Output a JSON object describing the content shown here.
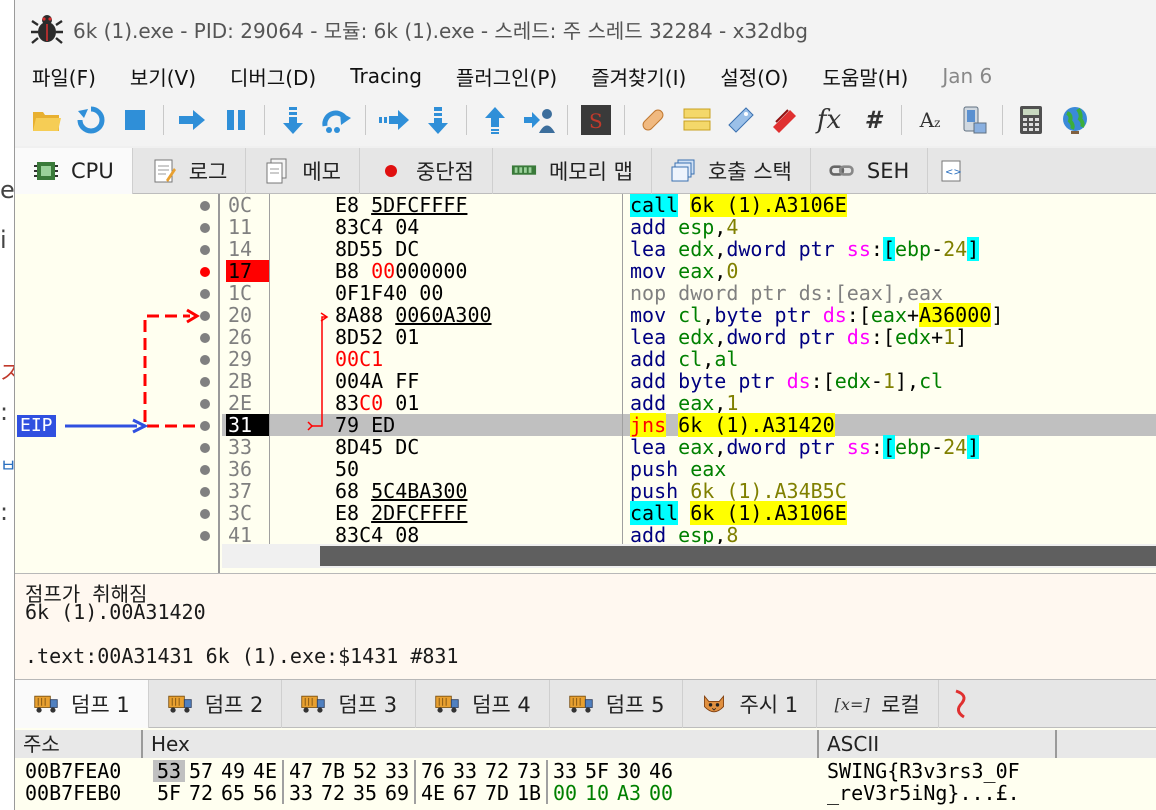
{
  "window": {
    "title": "6k (1).exe - PID: 29064 - 모듈: 6k (1).exe - 스레드: 주 스레드 32284 - x32dbg"
  },
  "background_fragments": [
    "e",
    "i",
    "ス",
    ":",
    "ㅂ",
    ":"
  ],
  "menu": [
    "파일(F)",
    "보기(V)",
    "디버그(D)",
    "Tracing",
    "플러그인(P)",
    "즐겨찾기(I)",
    "설정(O)",
    "도움말(H)",
    "Jan 6"
  ],
  "toolbar_icons": [
    "open-folder-icon",
    "restart-icon",
    "stop-icon",
    "run-arrow-icon",
    "pause-icon",
    "step-into-icon",
    "step-over-icon",
    "trace-into-icon",
    "trace-over-icon",
    "execute-till-return-icon",
    "run-to-user-code-icon",
    "scylla-icon",
    "patch-icon",
    "comments-icon",
    "labels-icon",
    "bookmarks-icon",
    "functions-icon",
    "hash-icon",
    "font-size-icon",
    "calculator-icon",
    "globe-icon"
  ],
  "cpu_tabs": [
    {
      "label": "CPU",
      "icon": "cpu-chip-icon"
    },
    {
      "label": "로그",
      "icon": "log-notepad-icon"
    },
    {
      "label": "메모",
      "icon": "notes-icon"
    },
    {
      "label": "중단점",
      "icon": "breakpoint-dot-icon"
    },
    {
      "label": "메모리 맵",
      "icon": "memory-map-icon"
    },
    {
      "label": "호출 스택",
      "icon": "call-stack-icon"
    },
    {
      "label": "SEH",
      "icon": "seh-chain-icon"
    }
  ],
  "gutter": {
    "eip_label": "EIP"
  },
  "disasm": [
    {
      "addr": "0C",
      "bytes": "E8 5DFCFFFF",
      "ins": "call 6k (1).A3106E"
    },
    {
      "addr": "11",
      "bytes": "83C4 04",
      "ins": "add esp,4"
    },
    {
      "addr": "14",
      "bytes": "8D55 DC",
      "ins": "lea edx,dword ptr ss:[ebp-24]"
    },
    {
      "addr": "17",
      "bytes": "B8 00000000",
      "ins": "mov eax,0",
      "breakpoint": true
    },
    {
      "addr": "1C",
      "bytes": "0F1F40 00",
      "ins": "nop dword ptr ds:[eax],eax"
    },
    {
      "addr": "20",
      "bytes": "8A88 0060A300",
      "ins": "mov cl,byte ptr ds:[eax+A36000]"
    },
    {
      "addr": "26",
      "bytes": "8D52 01",
      "ins": "lea edx,dword ptr ds:[edx+1]"
    },
    {
      "addr": "29",
      "bytes": "00C1",
      "ins": "add cl,al"
    },
    {
      "addr": "2B",
      "bytes": "004A FF",
      "ins": "add byte ptr ds:[edx-1],cl"
    },
    {
      "addr": "2E",
      "bytes": "83C0 01",
      "ins": "add eax,1"
    },
    {
      "addr": "31",
      "bytes": "79 ED",
      "ins": "jns 6k (1).A31420",
      "eip": true
    },
    {
      "addr": "33",
      "bytes": "8D45 DC",
      "ins": "lea eax,dword ptr ss:[ebp-24]"
    },
    {
      "addr": "36",
      "bytes": "50",
      "ins": "push eax"
    },
    {
      "addr": "37",
      "bytes": "68 5C4BA300",
      "ins": "push 6k (1).A34B5C"
    },
    {
      "addr": "3C",
      "bytes": "E8 2DFCFFFF",
      "ins": "call 6k (1).A3106E"
    },
    {
      "addr": "41",
      "bytes": "83C4 08",
      "ins": "add esp,8"
    }
  ],
  "info": {
    "line1": "점프가 취해짐",
    "line2": "6k (1).00A31420",
    "line3": ".text:00A31431 6k (1).exe:$1431 #831"
  },
  "dump_tabs": [
    {
      "label": "덤프 1",
      "icon": "dump-truck-icon"
    },
    {
      "label": "덤프 2",
      "icon": "dump-truck-icon"
    },
    {
      "label": "덤프 3",
      "icon": "dump-truck-icon"
    },
    {
      "label": "덤프 4",
      "icon": "dump-truck-icon"
    },
    {
      "label": "덤프 5",
      "icon": "dump-truck-icon"
    },
    {
      "label": "주시 1",
      "icon": "watch-cat-icon"
    },
    {
      "label": "로컬",
      "icon": "locals-x-icon"
    }
  ],
  "dump": {
    "headers": {
      "address": "주소",
      "hex": "Hex",
      "ascii": "ASCII"
    },
    "rows": [
      {
        "addr": "00B7FEA0",
        "hex": [
          "53",
          "57",
          "49",
          "4E",
          "47",
          "7B",
          "52",
          "33",
          "76",
          "33",
          "72",
          "73",
          "33",
          "5F",
          "30",
          "46"
        ],
        "ascii": "SWING{R3v3rs3_0F"
      },
      {
        "addr": "00B7FEB0",
        "hex": [
          "5F",
          "72",
          "65",
          "56",
          "33",
          "72",
          "35",
          "69",
          "4E",
          "67",
          "7D",
          "1B",
          "00",
          "10",
          "A3",
          "00"
        ],
        "ascii": "_reV3r5iNg}...£."
      }
    ]
  }
}
